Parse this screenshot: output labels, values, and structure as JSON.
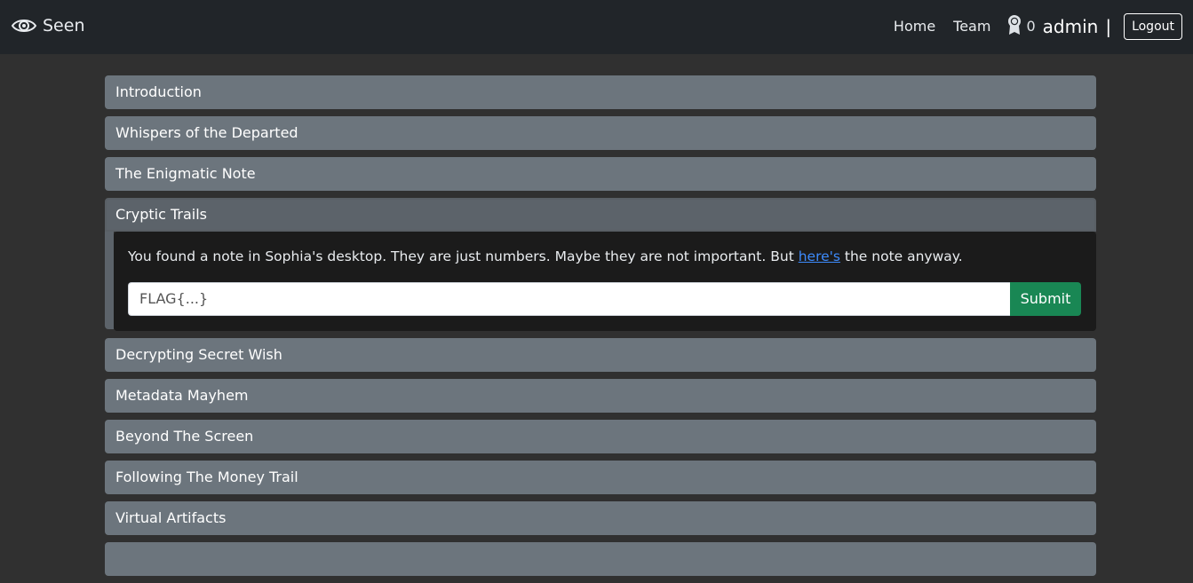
{
  "navbar": {
    "brand": "Seen",
    "links": {
      "home": "Home",
      "team": "Team"
    },
    "score": "0",
    "username": "admin",
    "separator": "|",
    "logout_label": "Logout"
  },
  "challenges": {
    "items": [
      "Introduction",
      "Whispers of the Departed",
      "The Enigmatic Note",
      "Cryptic Trails",
      "Decrypting Secret Wish",
      "Metadata Mayhem",
      "Beyond The Screen",
      "Following The Money Trail",
      "Virtual Artifacts"
    ],
    "active": {
      "text_before": "You found a note in Sophia's desktop. They are just numbers. Maybe they are not important. But ",
      "link": "here's",
      "text_after": " the note anyway.",
      "input_placeholder": "FLAG{...}",
      "submit_label": "Submit"
    }
  },
  "colors": {
    "navbar_bg": "#212529",
    "page_bg": "#303030",
    "item_bg": "#6c757d",
    "submit_bg": "#198754"
  }
}
